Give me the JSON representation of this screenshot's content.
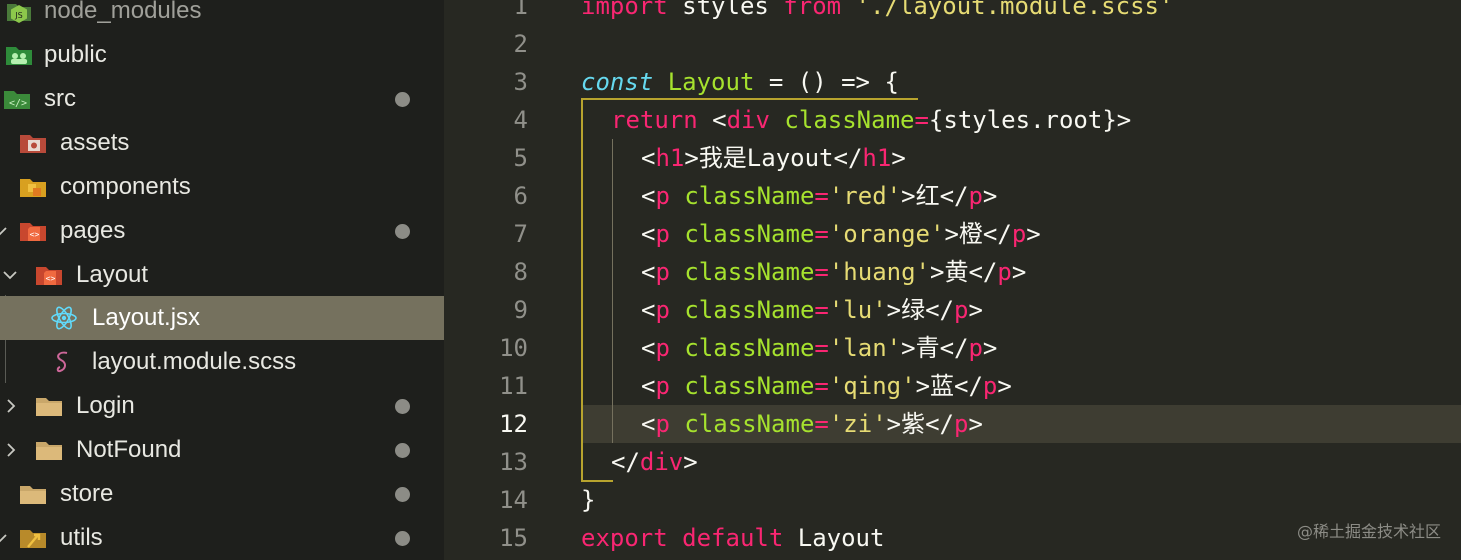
{
  "explorer": {
    "items": [
      {
        "label": "node_modules",
        "icon": "nodejs-folder-icon",
        "has_dot": false
      },
      {
        "label": "public",
        "icon": "public-folder-icon",
        "has_dot": false
      },
      {
        "label": "src",
        "icon": "src-folder-icon",
        "has_dot": true
      },
      {
        "label": "assets",
        "icon": "assets-folder-icon",
        "has_dot": false
      },
      {
        "label": "components",
        "icon": "components-folder-icon",
        "has_dot": false
      },
      {
        "label": "pages",
        "icon": "pages-folder-icon",
        "has_dot": true
      },
      {
        "label": "Layout",
        "icon": "pages-folder-icon",
        "has_dot": false
      },
      {
        "label": "Layout.jsx",
        "icon": "react-icon",
        "has_dot": false
      },
      {
        "label": "layout.module.scss",
        "icon": "sass-icon",
        "has_dot": false
      },
      {
        "label": "Login",
        "icon": "folder-icon",
        "has_dot": true
      },
      {
        "label": "NotFound",
        "icon": "folder-icon",
        "has_dot": true
      },
      {
        "label": "store",
        "icon": "folder-icon",
        "has_dot": true
      },
      {
        "label": "utils",
        "icon": "utils-folder-icon",
        "has_dot": true
      }
    ],
    "selected": "Layout.jsx"
  },
  "editor": {
    "current_line": "12",
    "lines": [
      {
        "n": "1"
      },
      {
        "n": "2"
      },
      {
        "n": "3"
      },
      {
        "n": "4"
      },
      {
        "n": "5"
      },
      {
        "n": "6"
      },
      {
        "n": "7"
      },
      {
        "n": "8"
      },
      {
        "n": "9"
      },
      {
        "n": "10"
      },
      {
        "n": "11"
      },
      {
        "n": "12"
      },
      {
        "n": "13"
      },
      {
        "n": "14"
      },
      {
        "n": "15"
      }
    ],
    "code": {
      "l1": {
        "import": "import",
        "styles": " styles ",
        "from": "from",
        "path": " './layout.module.scss'"
      },
      "l3": {
        "const": "const",
        "name": "Layout",
        "rest": " = () => {"
      },
      "l4": {
        "ret": "return",
        "lt": " <",
        "tag": "div",
        "attr": " className",
        "eq": "=",
        "val": "{styles.root}",
        "gt": ">"
      },
      "l5": {
        "lt": "<",
        "tag": "h1",
        "gt": ">",
        "text": "我是Layout",
        "close": "</",
        "ctag": "h1",
        "cgt": ">"
      },
      "l6": {
        "lt": "<",
        "tag": "p",
        "attr": " className",
        "eq": "=",
        "val": "'red'",
        "gt": ">",
        "text": "红",
        "close": "</",
        "ctag": "p",
        "cgt": ">"
      },
      "l7": {
        "lt": "<",
        "tag": "p",
        "attr": " className",
        "eq": "=",
        "val": "'orange'",
        "gt": ">",
        "text": "橙",
        "close": "</",
        "ctag": "p",
        "cgt": ">"
      },
      "l8": {
        "lt": "<",
        "tag": "p",
        "attr": " className",
        "eq": "=",
        "val": "'huang'",
        "gt": ">",
        "text": "黄",
        "close": "</",
        "ctag": "p",
        "cgt": ">"
      },
      "l9": {
        "lt": "<",
        "tag": "p",
        "attr": " className",
        "eq": "=",
        "val": "'lu'",
        "gt": ">",
        "text": "绿",
        "close": "</",
        "ctag": "p",
        "cgt": ">"
      },
      "l10": {
        "lt": "<",
        "tag": "p",
        "attr": " className",
        "eq": "=",
        "val": "'lan'",
        "gt": ">",
        "text": "青",
        "close": "</",
        "ctag": "p",
        "cgt": ">"
      },
      "l11": {
        "lt": "<",
        "tag": "p",
        "attr": " className",
        "eq": "=",
        "val": "'qing'",
        "gt": ">",
        "text": "蓝",
        "close": "</",
        "ctag": "p",
        "cgt": ">"
      },
      "l12": {
        "lt": "<",
        "tag": "p",
        "attr": " className",
        "eq": "=",
        "val": "'zi'",
        "gt": ">",
        "text": "紫",
        "close": "</",
        "ctag": "p",
        "cgt": ">"
      },
      "l13": {
        "close": "</",
        "tag": "div",
        "gt": ">"
      },
      "l14": {
        "brace": "}"
      },
      "l15": {
        "export": "export",
        "default": " default",
        "name": " Layout"
      }
    }
  },
  "watermark": "@稀土掘金技术社区",
  "colors": {
    "keyword": "#f92672",
    "string": "#e6db74",
    "attribute": "#a6e22e",
    "background": "#272822",
    "sidebar": "#1e1f1c",
    "selection": "#75715e"
  }
}
